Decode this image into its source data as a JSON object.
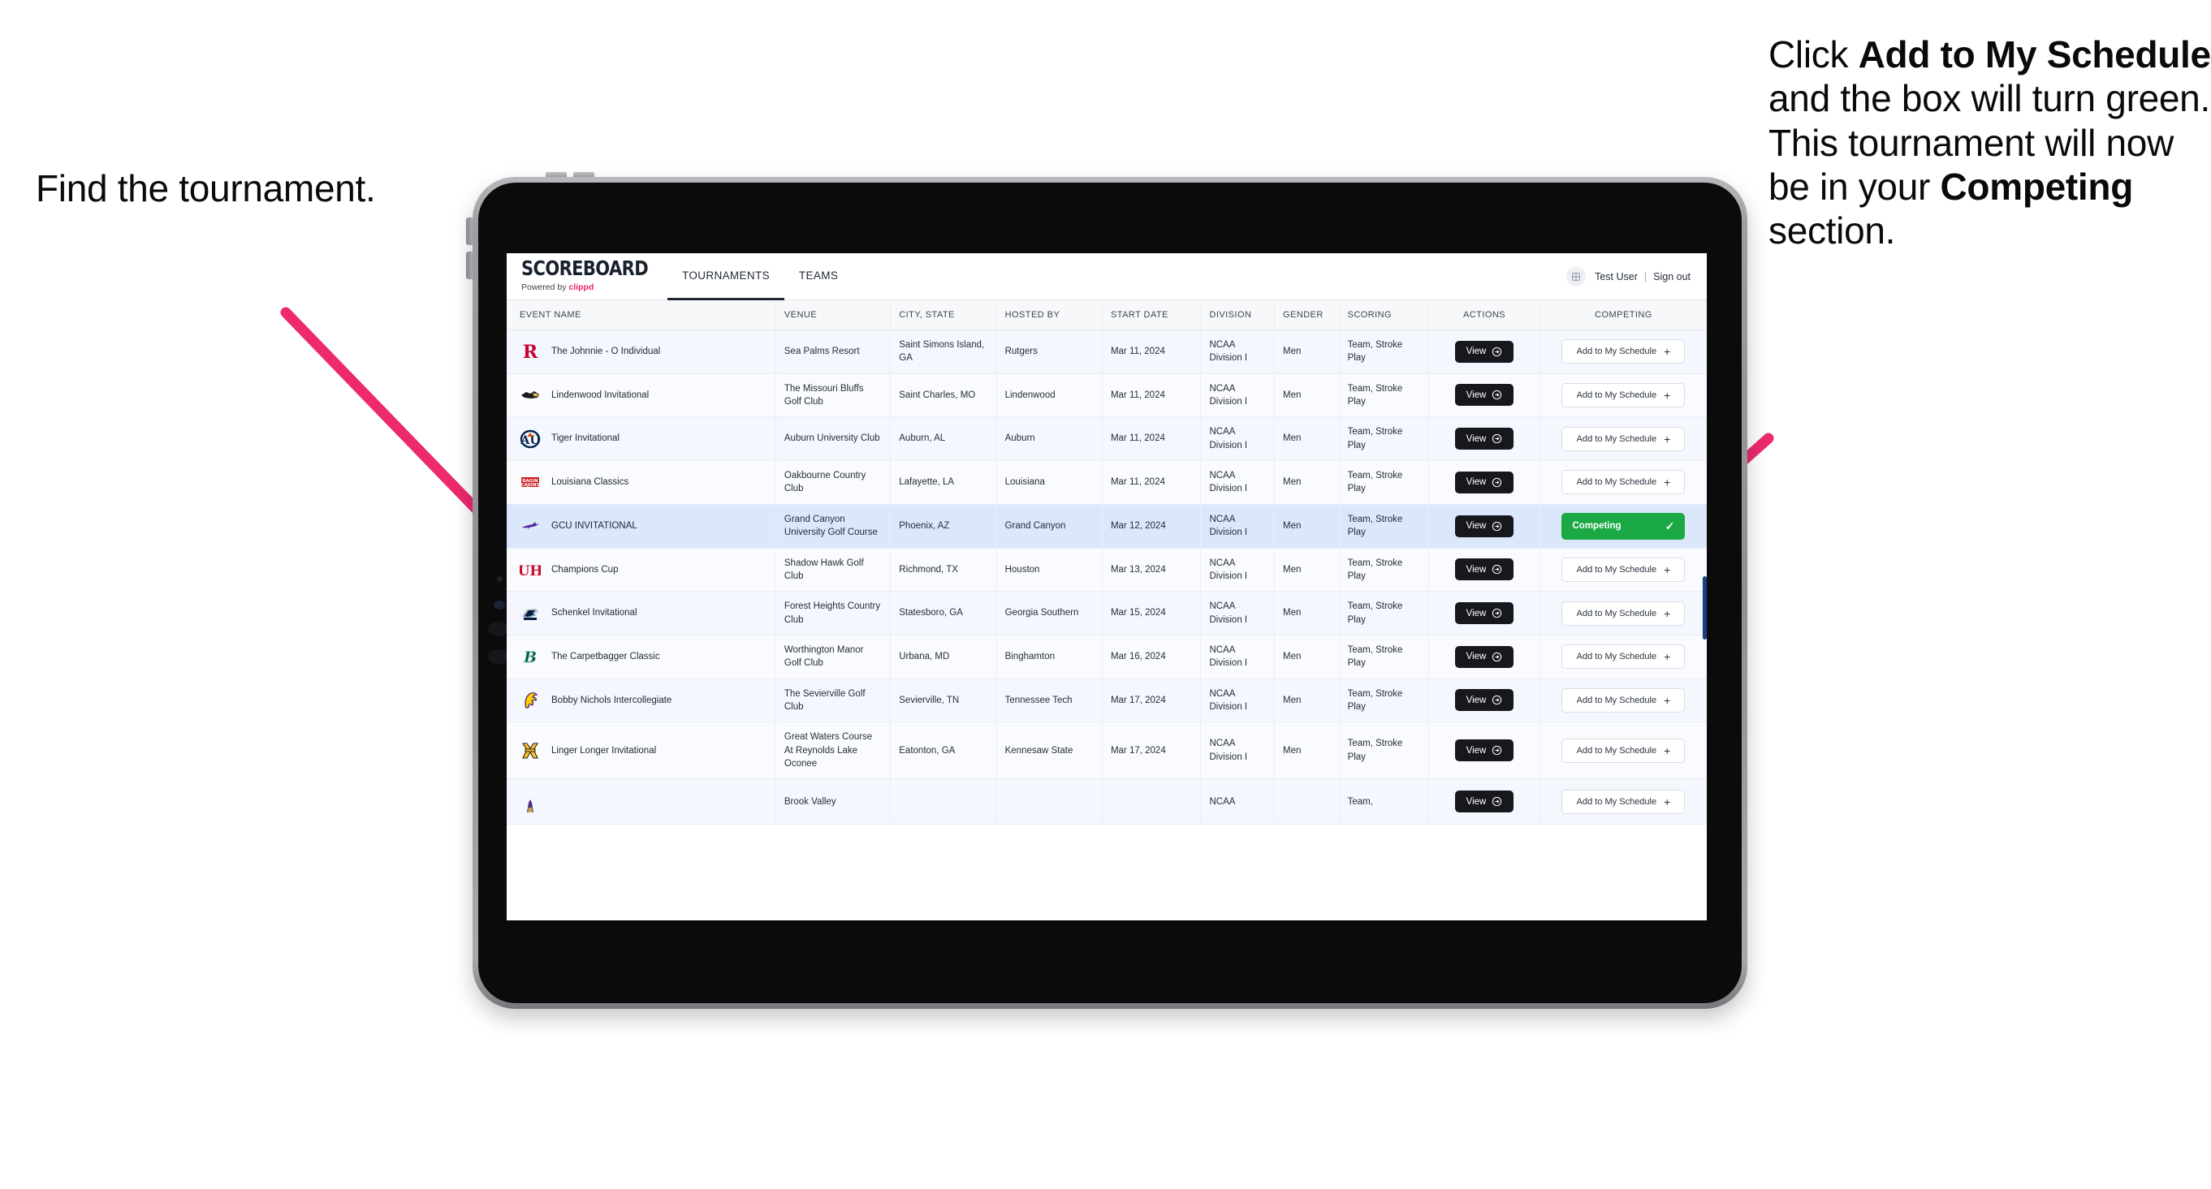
{
  "annotations": {
    "left": "Find the tournament.",
    "right_parts": [
      {
        "text": "Click ",
        "bold": false
      },
      {
        "text": "Add to My Schedule",
        "bold": true
      },
      {
        "text": " and the box will turn green. This tournament will now be in your ",
        "bold": false
      },
      {
        "text": "Competing",
        "bold": true
      },
      {
        "text": " section.",
        "bold": false
      }
    ],
    "arrow_color": "#ed2a6e"
  },
  "app": {
    "brand": {
      "title": "SCOREBOARD",
      "powered_prefix": "Powered by ",
      "powered_name": "clippd"
    },
    "nav": {
      "tabs": [
        {
          "label": "TOURNAMENTS",
          "active": true
        },
        {
          "label": "TEAMS",
          "active": false
        }
      ],
      "user_name": "Test User",
      "separator": "|",
      "sign_out": "Sign out",
      "avatar_icon": "user-avatar-icon"
    },
    "table": {
      "columns": [
        "EVENT NAME",
        "VENUE",
        "CITY, STATE",
        "HOSTED BY",
        "START DATE",
        "DIVISION",
        "GENDER",
        "SCORING",
        "ACTIONS",
        "COMPETING"
      ],
      "action_label": "View",
      "add_label": "Add to My Schedule",
      "add_plus": "+",
      "competing_label": "Competing",
      "competing_check": "✓",
      "competing_color": "#1aa944",
      "rows": [
        {
          "logo": "rutgers-logo",
          "event": "The Johnnie - O Individual",
          "venue": "Sea Palms Resort",
          "city": "Saint Simons Island, GA",
          "host": "Rutgers",
          "date": "Mar 11, 2024",
          "division": "NCAA Division I",
          "gender": "Men",
          "scoring": "Team, Stroke Play",
          "competing": false
        },
        {
          "logo": "lindenwood-logo",
          "event": "Lindenwood Invitational",
          "venue": "The Missouri Bluffs Golf Club",
          "city": "Saint Charles, MO",
          "host": "Lindenwood",
          "date": "Mar 11, 2024",
          "division": "NCAA Division I",
          "gender": "Men",
          "scoring": "Team, Stroke Play",
          "competing": false
        },
        {
          "logo": "auburn-logo",
          "event": "Tiger Invitational",
          "venue": "Auburn University Club",
          "city": "Auburn, AL",
          "host": "Auburn",
          "date": "Mar 11, 2024",
          "division": "NCAA Division I",
          "gender": "Men",
          "scoring": "Team, Stroke Play",
          "competing": false
        },
        {
          "logo": "louisiana-logo",
          "event": "Louisiana Classics",
          "venue": "Oakbourne Country Club",
          "city": "Lafayette, LA",
          "host": "Louisiana",
          "date": "Mar 11, 2024",
          "division": "NCAA Division I",
          "gender": "Men",
          "scoring": "Team, Stroke Play",
          "competing": false
        },
        {
          "logo": "gcu-logo",
          "event": "GCU INVITATIONAL",
          "venue": "Grand Canyon University Golf Course",
          "city": "Phoenix, AZ",
          "host": "Grand Canyon",
          "date": "Mar 12, 2024",
          "division": "NCAA Division I",
          "gender": "Men",
          "scoring": "Team, Stroke Play",
          "competing": true
        },
        {
          "logo": "houston-logo",
          "event": "Champions Cup",
          "venue": "Shadow Hawk Golf Club",
          "city": "Richmond, TX",
          "host": "Houston",
          "date": "Mar 13, 2024",
          "division": "NCAA Division I",
          "gender": "Men",
          "scoring": "Team, Stroke Play",
          "competing": false
        },
        {
          "logo": "georgia-southern-logo",
          "event": "Schenkel Invitational",
          "venue": "Forest Heights Country Club",
          "city": "Statesboro, GA",
          "host": "Georgia Southern",
          "date": "Mar 15, 2024",
          "division": "NCAA Division I",
          "gender": "Men",
          "scoring": "Team, Stroke Play",
          "competing": false
        },
        {
          "logo": "binghamton-logo",
          "event": "The Carpetbagger Classic",
          "venue": "Worthington Manor Golf Club",
          "city": "Urbana, MD",
          "host": "Binghamton",
          "date": "Mar 16, 2024",
          "division": "NCAA Division I",
          "gender": "Men",
          "scoring": "Team, Stroke Play",
          "competing": false
        },
        {
          "logo": "tennessee-tech-logo",
          "event": "Bobby Nichols Intercollegiate",
          "venue": "The Sevierville Golf Club",
          "city": "Sevierville, TN",
          "host": "Tennessee Tech",
          "date": "Mar 17, 2024",
          "division": "NCAA Division I",
          "gender": "Men",
          "scoring": "Team, Stroke Play",
          "competing": false
        },
        {
          "logo": "kennesaw-state-logo",
          "event": "Linger Longer Invitational",
          "venue": "Great Waters Course At Reynolds Lake Oconee",
          "city": "Eatonton, GA",
          "host": "Kennesaw State",
          "date": "Mar 17, 2024",
          "division": "NCAA Division I",
          "gender": "Men",
          "scoring": "Team, Stroke Play",
          "competing": false
        },
        {
          "logo": "partial-logo",
          "event": "",
          "venue": "Brook Valley",
          "city": "",
          "host": "",
          "date": "",
          "division": "NCAA",
          "gender": "",
          "scoring": "Team,",
          "competing": false,
          "partial": true
        }
      ]
    }
  }
}
